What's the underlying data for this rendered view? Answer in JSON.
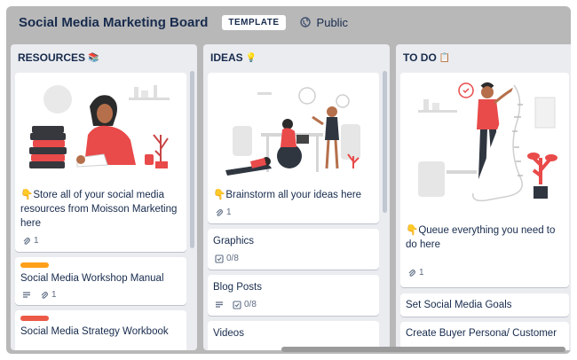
{
  "board": {
    "title": "Social Media Marketing Board",
    "badge": "TEMPLATE",
    "visibility": "Public",
    "visibility_icon": "globe-icon"
  },
  "lists": [
    {
      "title": "RESOURCES",
      "emoji": "📚",
      "cards": [
        {
          "text": "👇Store all of your social media resources from Moisson Marketing here",
          "attachments": "1",
          "cover": "woman-reading-books-illustration"
        },
        {
          "text": "Social Media Workshop Manual",
          "label_color": "#ff9f1a",
          "attachments": "1",
          "has_description": true
        },
        {
          "text": "Social Media Strategy Workbook",
          "label_color": "#eb5a46"
        }
      ]
    },
    {
      "title": "IDEAS",
      "emoji": "💡",
      "cards": [
        {
          "text": "👇Brainstorm all your ideas here",
          "attachments": "1",
          "cover": "team-brainstorm-illustration"
        },
        {
          "text": "Graphics",
          "checklist": "0/8"
        },
        {
          "text": "Blog Posts",
          "checklist": "0/8",
          "has_description": true
        },
        {
          "text": "Videos"
        }
      ]
    },
    {
      "title": "TO DO",
      "emoji": "📋",
      "cards": [
        {
          "text": "👇Queue everything you need to do here",
          "attachments": "1",
          "cover": "man-with-long-list-illustration"
        },
        {
          "text": "Set Social Media Goals"
        },
        {
          "text": "Create Buyer Persona/ Customer"
        }
      ]
    }
  ],
  "colors": {
    "board_bg": "#b8b8b8",
    "list_bg": "#ebecf0",
    "accent_red": "#e94a4a",
    "text": "#172b4d"
  }
}
